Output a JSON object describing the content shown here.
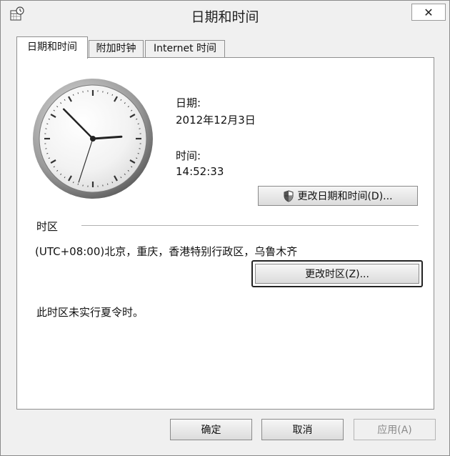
{
  "window": {
    "title": "日期和时间",
    "close_label": "✕"
  },
  "tabs": [
    {
      "label": "日期和时间",
      "active": true
    },
    {
      "label": "附加时钟",
      "active": false
    },
    {
      "label": "Internet 时间",
      "active": false
    }
  ],
  "clock": {
    "hour": 14,
    "minute": 52,
    "second": 33
  },
  "date": {
    "label": "日期:",
    "value": "2012年12月3日"
  },
  "time": {
    "label": "时间:",
    "value": "14:52:33"
  },
  "change_datetime_button": "更改日期和时间(D)...",
  "timezone": {
    "group_label": "时区",
    "value": "(UTC+08:00)北京，重庆，香港特别行政区，乌鲁木齐",
    "change_button": "更改时区(Z)...",
    "dst_note": "此时区未实行夏令时。"
  },
  "footer": {
    "ok": "确定",
    "cancel": "取消",
    "apply": "应用(A)"
  },
  "icons": {
    "title": "calendar-clock-icon",
    "shield": "uac-shield-icon"
  }
}
